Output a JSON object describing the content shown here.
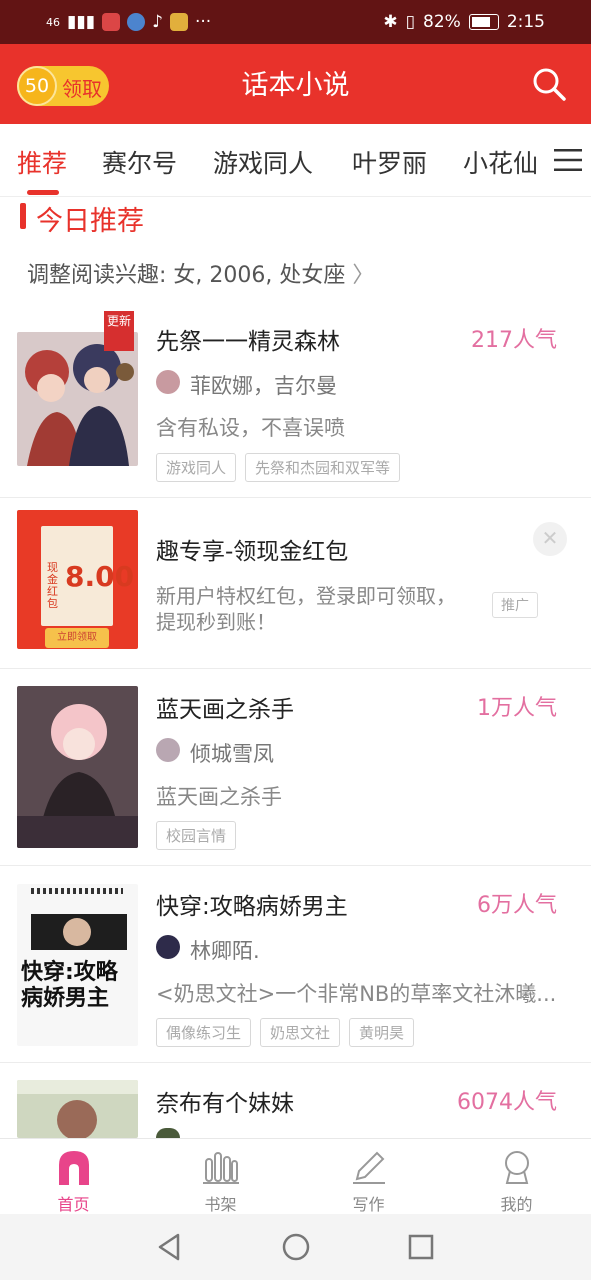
{
  "status_bar": {
    "network": "46",
    "battery": "82%",
    "time": "2:15"
  },
  "header": {
    "coin_count": "50",
    "reward_label": "领取",
    "title": "话本小说"
  },
  "tabs": [
    "推荐",
    "赛尔号",
    "游戏同人",
    "叶罗丽",
    "小花仙"
  ],
  "section": {
    "title": "今日推荐",
    "interest": "调整阅读兴趣: 女, 2006, 处女座"
  },
  "books": [
    {
      "title": "先祭一一精灵森林",
      "popularity": "217人气",
      "author": "菲欧娜，吉尔曼",
      "desc": "含有私设，不喜误喷",
      "tags": [
        "游戏同人",
        "先祭和杰园和双军等"
      ],
      "flag": "更新"
    },
    {
      "title": "蓝天画之杀手",
      "popularity": "1万人气",
      "author": "倾城雪凤",
      "desc": "蓝天画之杀手",
      "tags": [
        "校园言情"
      ]
    },
    {
      "title": "快穿:攻略病娇男主",
      "popularity": "6万人气",
      "author": "林卿陌.",
      "desc": "<奶思文社>一个非常NB的草率文社沐曦...",
      "tags": [
        "偶像练习生",
        "奶思文社",
        "黄明昊"
      ],
      "cover_text": "快穿:攻略病娇男主"
    },
    {
      "title": "奈布有个妹妹",
      "popularity": "6074人气"
    }
  ],
  "ad": {
    "title": "趣专享-领现金红包",
    "desc_line1": "新用户特权红包，登录即可领取，",
    "desc_line2": "提现秒到账！",
    "badge": "推广",
    "cover_amount": "8.00",
    "cover_label": "现金红包",
    "cover_button": "立即领取"
  },
  "bottom_nav": [
    "首页",
    "书架",
    "写作",
    "我的"
  ],
  "colors": {
    "primary": "#e8322b",
    "accent_pink": "#e8448a",
    "popularity": "#e36fa0"
  }
}
